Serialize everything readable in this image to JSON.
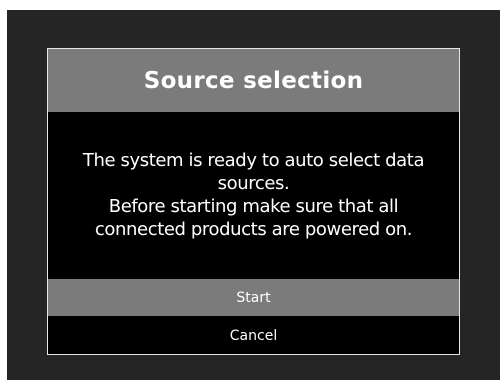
{
  "dialog": {
    "title": "Source selection",
    "message": "The system is ready to auto select data\nsources.\nBefore starting make sure that all\nconnected products are powered on.",
    "buttons": {
      "start": "Start",
      "cancel": "Cancel"
    },
    "colors": {
      "screen_background": "#252525",
      "header_background": "#7b7b7b",
      "body_background": "#000000",
      "selected_button": "#7b7b7b",
      "border": "#e6e6e6",
      "text": "#ffffff"
    }
  }
}
